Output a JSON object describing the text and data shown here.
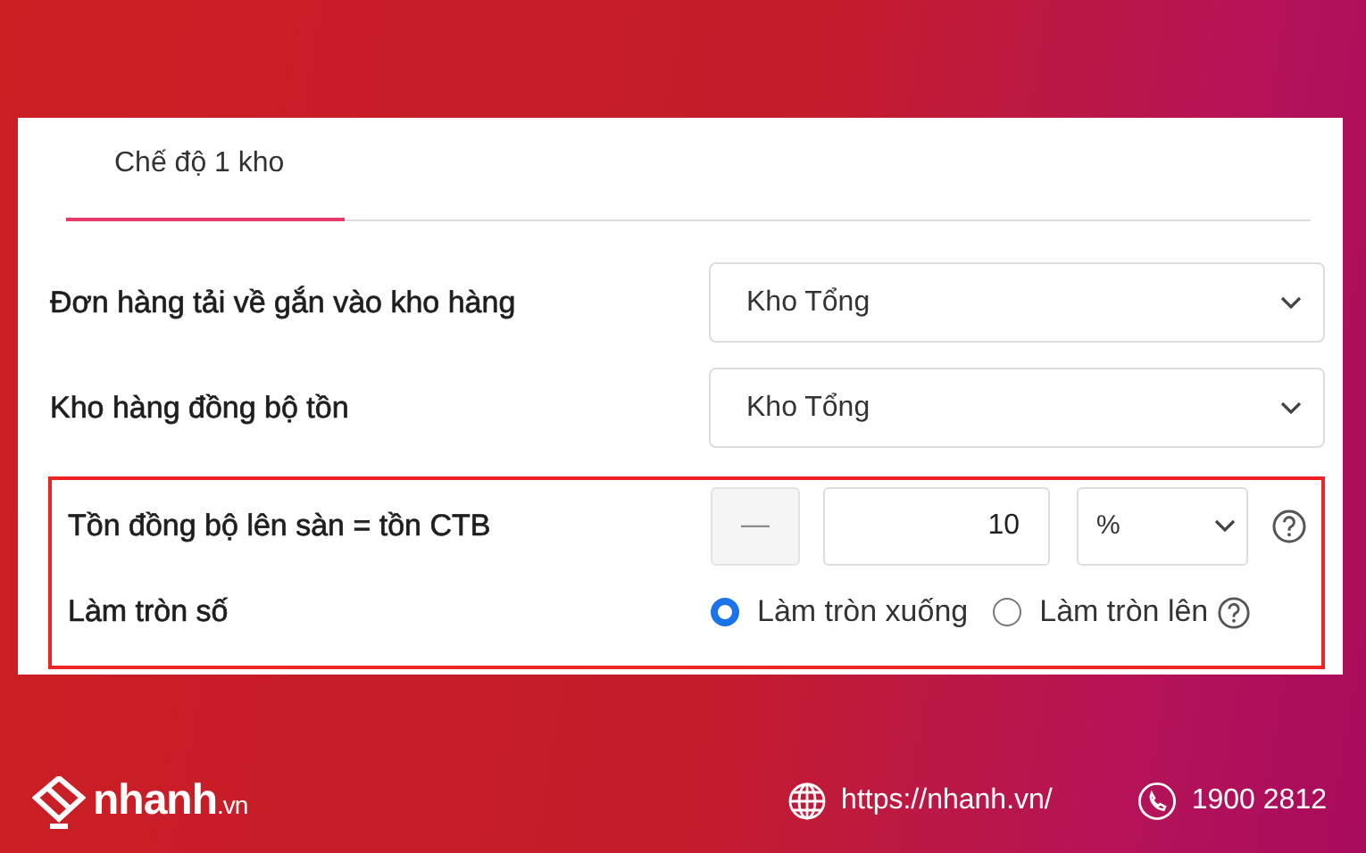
{
  "tabs": [
    {
      "label": "Chế độ 1 kho",
      "selected": true
    }
  ],
  "settings": [
    {
      "kind": "select",
      "label": "Đơn hàng tải về gắn vào kho hàng",
      "value": "Kho Tổng"
    },
    {
      "kind": "select",
      "label": "Kho hàng đồng bộ tồn",
      "value": "Kho Tổng"
    }
  ],
  "highlighted_settings": [
    {
      "kind": "stepper",
      "label": "Tồn đồng bộ lên sàn = tồn CTB",
      "button": "—",
      "value": "10",
      "unit": "%"
    },
    {
      "kind": "radio",
      "label": "Làm tròn số",
      "options": [
        {
          "label": "Làm tròn xuống",
          "selected": true
        },
        {
          "label": "Làm tròn lên",
          "selected": false
        }
      ]
    }
  ],
  "footer": {
    "brand": "nhanh",
    "brand_suffix": ".vn",
    "website": "https://nhanh.vn/",
    "phone": "1900 2812"
  }
}
